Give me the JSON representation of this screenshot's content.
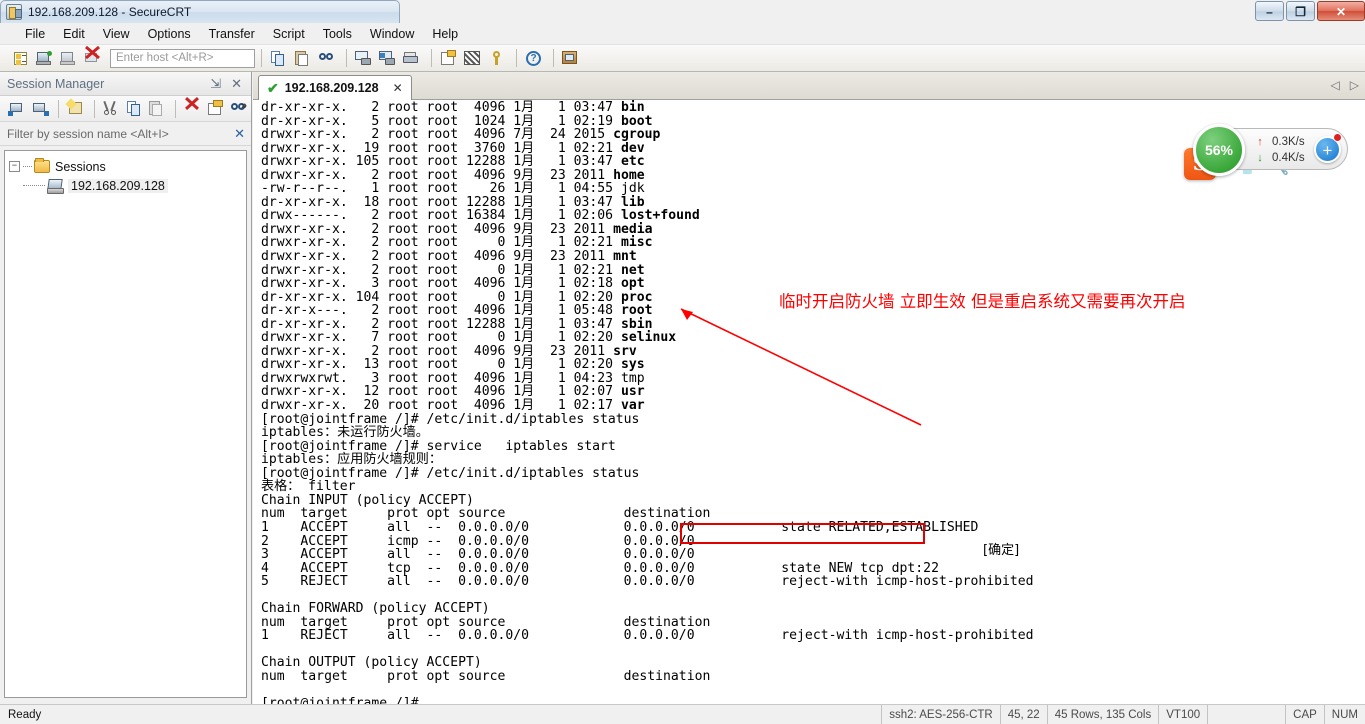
{
  "window": {
    "title": "192.168.209.128 - SecureCRT",
    "icon": "securecrt-icon",
    "minimize": "–",
    "maximize": "❐",
    "close": "✕"
  },
  "menubar": [
    "File",
    "Edit",
    "View",
    "Options",
    "Script",
    "Transfer",
    "Tools",
    "Window",
    "Help"
  ],
  "menubar_order": [
    "File",
    "Edit",
    "View",
    "Options",
    "Transfer",
    "Script",
    "Tools",
    "Window",
    "Help"
  ],
  "toolbar": {
    "host_placeholder": "Enter host <Alt+R>",
    "icons": [
      "session-manager-icon",
      "connect-icon",
      "connect-sftp-icon",
      "disconnect-icon",
      "copy-icon",
      "paste-icon",
      "find-icon",
      "print-screen-icon",
      "log-session-icon",
      "print-icon",
      "session-options-icon",
      "global-options-icon",
      "key-icon",
      "help-icon",
      "new-session-icon"
    ]
  },
  "session_manager": {
    "title": "Session Manager",
    "pin": "⇲",
    "close": "✕",
    "filter_placeholder": "Filter by session name <Alt+I>",
    "filter_clear": "✕",
    "toolbar_icons": [
      "connect-session-icon",
      "connect-in-tab-icon",
      "new-session-wizard-icon",
      "cut-icon",
      "copy-icon",
      "paste-icon",
      "delete-icon",
      "properties-icon",
      "find-icon"
    ],
    "toolbar_overflow": "»",
    "tree": {
      "expander": "−",
      "root_label": "Sessions",
      "root_icon": "folder-icon",
      "children": [
        {
          "label": "192.168.209.128",
          "icon": "session-icon",
          "selected": true
        }
      ]
    }
  },
  "tabs": {
    "items": [
      {
        "label": "192.168.209.128",
        "status_icon": "connected-check-icon",
        "close": "✕",
        "active": true
      }
    ],
    "nav_prev": "◁",
    "nav_next": "▷"
  },
  "terminal": {
    "lines": [
      {
        "text": "dr-xr-xr-x.   2 root root  4096 1月   1 03:47 ",
        "bold": "bin"
      },
      {
        "text": "dr-xr-xr-x.   5 root root  1024 1月   1 02:19 ",
        "bold": "boot"
      },
      {
        "text": "drwxr-xr-x.   2 root root  4096 7月  24 2015 ",
        "bold": "cgroup"
      },
      {
        "text": "drwxr-xr-x.  19 root root  3760 1月   1 02:21 ",
        "bold": "dev"
      },
      {
        "text": "drwxr-xr-x. 105 root root 12288 1月   1 03:47 ",
        "bold": "etc"
      },
      {
        "text": "drwxr-xr-x.   2 root root  4096 9月  23 2011 ",
        "bold": "home"
      },
      {
        "text": "-rw-r--r--.   1 root root    26 1月   1 04:55 ",
        "bold": "",
        "plain": "jdk"
      },
      {
        "text": "dr-xr-xr-x.  18 root root 12288 1月   1 03:47 ",
        "bold": "lib"
      },
      {
        "text": "drwx------.   2 root root 16384 1月   1 02:06 ",
        "bold": "lost+found"
      },
      {
        "text": "drwxr-xr-x.   2 root root  4096 9月  23 2011 ",
        "bold": "media"
      },
      {
        "text": "drwxr-xr-x.   2 root root     0 1月   1 02:21 ",
        "bold": "misc"
      },
      {
        "text": "drwxr-xr-x.   2 root root  4096 9月  23 2011 ",
        "bold": "mnt"
      },
      {
        "text": "drwxr-xr-x.   2 root root     0 1月   1 02:21 ",
        "bold": "net"
      },
      {
        "text": "drwxr-xr-x.   3 root root  4096 1月   1 02:18 ",
        "bold": "opt"
      },
      {
        "text": "dr-xr-xr-x. 104 root root     0 1月   1 02:20 ",
        "bold": "proc"
      },
      {
        "text": "dr-xr-x---.   2 root root  4096 1月   1 05:48 ",
        "bold": "root"
      },
      {
        "text": "dr-xr-xr-x.   2 root root 12288 1月   1 03:47 ",
        "bold": "sbin"
      },
      {
        "text": "drwxr-xr-x.   7 root root     0 1月   1 02:20 ",
        "bold": "selinux"
      },
      {
        "text": "drwxr-xr-x.   2 root root  4096 9月  23 2011 ",
        "bold": "srv"
      },
      {
        "text": "drwxr-xr-x.  13 root root     0 1月   1 02:20 ",
        "bold": "sys"
      },
      {
        "text": "drwxrwxrwt.   3 root root  4096 1月   1 04:23 ",
        "bold": "",
        "plain": "tmp"
      },
      {
        "text": "drwxr-xr-x.  12 root root  4096 1月   1 02:07 ",
        "bold": "usr"
      },
      {
        "text": "drwxr-xr-x.  20 root root  4096 1月   1 02:17 ",
        "bold": "var"
      },
      {
        "text": "[root@jointframe /]# /etc/init.d/iptables status"
      },
      {
        "text": "iptables：未运行防火墙。"
      },
      {
        "text": "[root@jointframe /]# service   iptables start"
      },
      {
        "text": "iptables：应用防火墙规则："
      },
      {
        "text": "[root@jointframe /]# /etc/init.d/iptables status"
      },
      {
        "text": "表格： filter"
      },
      {
        "text": "Chain INPUT (policy ACCEPT)"
      },
      {
        "text": "num  target     prot opt source               destination"
      },
      {
        "text": "1    ACCEPT     all  --  0.0.0.0/0            0.0.0.0/0           state RELATED,ESTABLISHED"
      },
      {
        "text": "2    ACCEPT     icmp --  0.0.0.0/0            0.0.0.0/0"
      },
      {
        "text": "3    ACCEPT     all  --  0.0.0.0/0            0.0.0.0/0"
      },
      {
        "text": "4    ACCEPT     tcp  --  0.0.0.0/0            0.0.0.0/0           state NEW tcp dpt:22"
      },
      {
        "text": "5    REJECT     all  --  0.0.0.0/0            0.0.0.0/0           reject-with icmp-host-prohibited"
      },
      {
        "text": ""
      },
      {
        "text": "Chain FORWARD (policy ACCEPT)"
      },
      {
        "text": "num  target     prot opt source               destination"
      },
      {
        "text": "1    REJECT     all  --  0.0.0.0/0            0.0.0.0/0           reject-with icmp-host-prohibited"
      },
      {
        "text": ""
      },
      {
        "text": "Chain OUTPUT (policy ACCEPT)"
      },
      {
        "text": "num  target     prot opt source               destination"
      },
      {
        "text": ""
      },
      {
        "text": "[root@jointframe /]#"
      }
    ]
  },
  "annotations": {
    "red_note": "临时开启防火墙  立即生效 但是重启系统又需要再次开启",
    "confirm_text": "[确定]",
    "highlight_color": "#ff0000",
    "boxed_command": "service   iptables start"
  },
  "speed_widget": {
    "cpu_percent": "56%",
    "upload": "0.3K/s",
    "download": "0.4K/s",
    "up_arrow": "↑",
    "down_arrow": "↓",
    "add_button": "+",
    "sogou_logo": "S"
  },
  "statusbar": {
    "ready": "Ready",
    "protocol": "ssh2: AES-256-CTR",
    "cursor": "45, 22",
    "dimensions": "45 Rows, 135 Cols",
    "emulation": "VT100",
    "blank": "",
    "cap": "CAP",
    "num": "NUM"
  }
}
